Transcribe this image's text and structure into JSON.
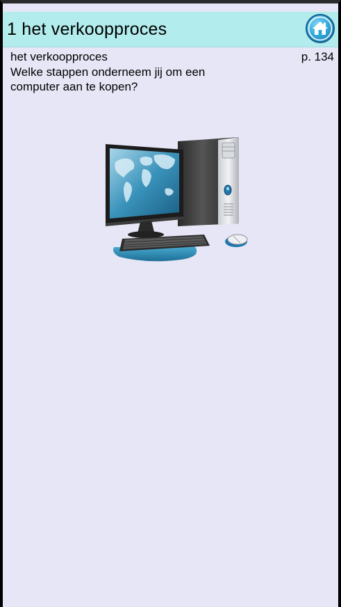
{
  "header": {
    "title": "1 het verkoopproces",
    "home_icon": "home-icon"
  },
  "content": {
    "subtitle": "het verkoopproces",
    "page_ref": "p. 134",
    "question": "Welke stappen onderneem jij om een computer aan te kopen?",
    "illustration": "desktop-computer-illustration"
  },
  "colors": {
    "header_bg": "#b2ecec",
    "page_bg": "#e6e6f6",
    "home_button": "#2fa6d8"
  }
}
